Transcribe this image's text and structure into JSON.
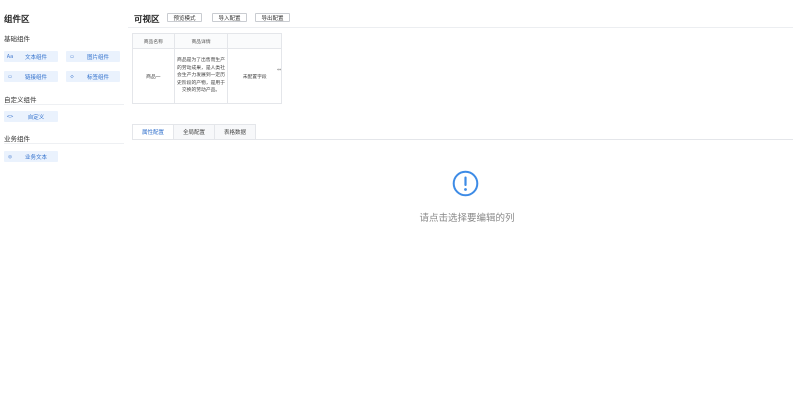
{
  "sidebar": {
    "title": "组件区",
    "groups": [
      {
        "title": "基础组件"
      },
      {
        "title": "自定义组件"
      },
      {
        "title": "业务组件"
      }
    ],
    "basic_items": [
      {
        "icon": "Aa",
        "label": "文本组件"
      },
      {
        "icon": "▭",
        "label": "图片组件"
      },
      {
        "icon": "▭",
        "label": "链接组件"
      },
      {
        "icon": "◇",
        "label": "标签组件"
      }
    ],
    "custom_items": [
      {
        "icon": "<>",
        "label": "自定义"
      }
    ],
    "business_items": [
      {
        "icon": "◎",
        "label": "业务文本"
      }
    ]
  },
  "canvas": {
    "title": "可视区",
    "toolbar": {
      "preview": "预览模式",
      "import": "导入配置",
      "export": "导出配置"
    },
    "table": {
      "headers": [
        "商品名称",
        "商品详情",
        ""
      ],
      "row": {
        "name": "商品一",
        "detail": "商品是为了出售而生产的劳动成果，是人类社会生产力发展到一定历史阶段的产物，是用于交换的劳动产品。",
        "extra": "未配置字段"
      }
    }
  },
  "tabs": {
    "items": [
      "属性配置",
      "全局配置",
      "表格数据"
    ],
    "active": 0
  },
  "empty_state": {
    "message": "请点击选择要编辑的列"
  },
  "colors": {
    "accent": "#2f6fcc",
    "chip_bg": "#eaf2fd",
    "icon_blue": "#3d8be6"
  }
}
